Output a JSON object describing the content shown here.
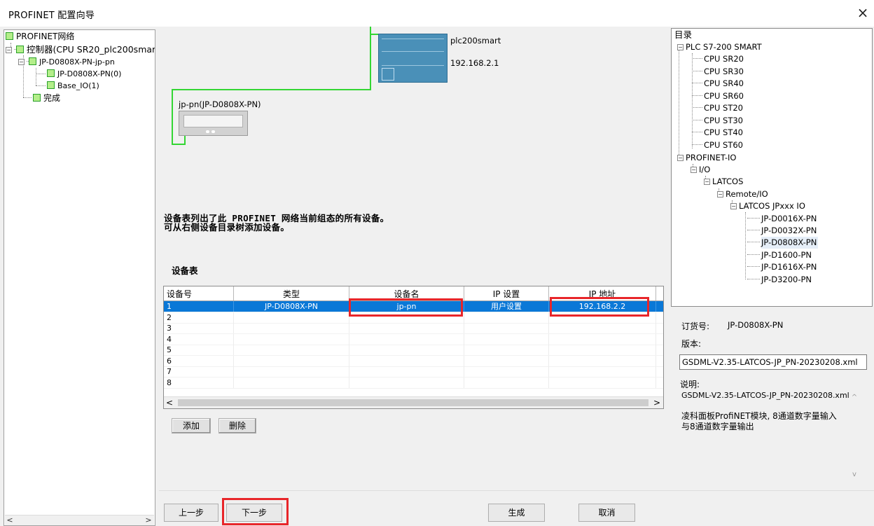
{
  "window": {
    "title": "PROFINET 配置向导",
    "close_symbol": "×"
  },
  "left_tree": {
    "items": [
      {
        "label": "PROFINET网络"
      },
      {
        "label": "控制器(CPU SR20_plc200smart)"
      },
      {
        "label": "JP-D0808X-PN-jp-pn"
      },
      {
        "label": "JP-D0808X-PN(0)"
      },
      {
        "label": "Base_IO(1)"
      },
      {
        "label": "完成"
      }
    ],
    "expand_symbol": "−"
  },
  "diagram": {
    "plc_name": "plc200smart",
    "plc_ip": "192.168.2.1",
    "io_label": "jp-pn(JP-D0808X-PN)",
    "line_color": "#33d633"
  },
  "info_text": {
    "line1": "设备表列出了此 PROFINET 网络当前组态的所有设备。",
    "line2": "可从右侧设备目录树添加设备。"
  },
  "device_table": {
    "title": "设备表",
    "columns": [
      "设备号",
      "类型",
      "设备名",
      "IP 设置",
      "IP 地址"
    ],
    "rows": [
      {
        "no": "1",
        "type": "JP-D0808X-PN",
        "name": "jp-pn",
        "ip_setting": "用户设置",
        "ip": "192.168.2.2"
      },
      {
        "no": "2",
        "type": "",
        "name": "",
        "ip_setting": "",
        "ip": ""
      },
      {
        "no": "3",
        "type": "",
        "name": "",
        "ip_setting": "",
        "ip": ""
      },
      {
        "no": "4",
        "type": "",
        "name": "",
        "ip_setting": "",
        "ip": ""
      },
      {
        "no": "5",
        "type": "",
        "name": "",
        "ip_setting": "",
        "ip": ""
      },
      {
        "no": "6",
        "type": "",
        "name": "",
        "ip_setting": "",
        "ip": ""
      },
      {
        "no": "7",
        "type": "",
        "name": "",
        "ip_setting": "",
        "ip": ""
      },
      {
        "no": "8",
        "type": "",
        "name": "",
        "ip_setting": "",
        "ip": ""
      }
    ],
    "scroll_left": "<",
    "scroll_right": ">"
  },
  "buttons": {
    "add": "添加",
    "delete": "删除",
    "prev": "上一步",
    "next": "下一步",
    "generate": "生成",
    "cancel": "取消"
  },
  "catalog": {
    "items": [
      {
        "label": "目录"
      },
      {
        "label": "PLC S7-200 SMART"
      },
      {
        "label": "CPU SR20"
      },
      {
        "label": "CPU SR30"
      },
      {
        "label": "CPU SR40"
      },
      {
        "label": "CPU SR60"
      },
      {
        "label": "CPU ST20"
      },
      {
        "label": "CPU ST30"
      },
      {
        "label": "CPU ST40"
      },
      {
        "label": "CPU ST60"
      },
      {
        "label": "PROFINET-IO"
      },
      {
        "label": "I/O"
      },
      {
        "label": "LATCOS"
      },
      {
        "label": "Remote/IO"
      },
      {
        "label": "LATCOS JPxxx IO"
      },
      {
        "label": "JP-D0016X-PN"
      },
      {
        "label": "JP-D0032X-PN"
      },
      {
        "label": "JP-D0808X-PN"
      },
      {
        "label": "JP-D1600-PN"
      },
      {
        "label": "JP-D1616X-PN"
      },
      {
        "label": "JP-D3200-PN"
      }
    ]
  },
  "properties": {
    "order_label": "订货号:",
    "order_value": "JP-D0808X-PN",
    "version_label": "版本:",
    "version_value": "GSDML-V2.35-LATCOS-JP_PN-20230208.xml",
    "desc_label": "说明:",
    "desc_file": "GSDML-V2.35-LATCOS-JP_PN-20230208.xml",
    "desc_line1": "凌科面板ProfiNET模块, 8通道数字量输入",
    "desc_line2": "与8通道数字量输出"
  },
  "colors": {
    "highlight": "#e8262a",
    "selection": "#0a78d7"
  }
}
